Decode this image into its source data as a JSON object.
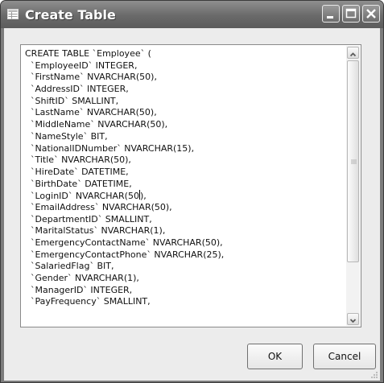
{
  "window": {
    "title": "Create Table"
  },
  "editor": {
    "lines": [
      "CREATE TABLE `Employee` (",
      "  `EmployeeID` INTEGER,",
      "  `FirstName` NVARCHAR(50),",
      "  `AddressID` INTEGER,",
      "  `ShiftID` SMALLINT,",
      "  `LastName` NVARCHAR(50),",
      "  `MiddleName` NVARCHAR(50),",
      "  `NameStyle` BIT,",
      "  `NationalIDNumber` NVARCHAR(15),",
      "  `Title` NVARCHAR(50),",
      "  `HireDate` DATETIME,",
      "  `BirthDate` DATETIME,",
      "  `LoginID` NVARCHAR(50),",
      "  `EmailAddress` NVARCHAR(50),",
      "  `DepartmentID` SMALLINT,",
      "  `MaritalStatus` NVARCHAR(1),",
      "  `EmergencyContactName` NVARCHAR(50),",
      "  `EmergencyContactPhone` NVARCHAR(25),",
      "  `SalariedFlag` BIT,",
      "  `Gender` NVARCHAR(1),",
      "  `ManagerID` INTEGER,",
      "  `PayFrequency` SMALLINT,"
    ]
  },
  "buttons": {
    "ok_label": "OK",
    "cancel_label": "Cancel"
  },
  "icons": {
    "app": "table-window-icon",
    "minimize": "minimize-icon",
    "maximize": "maximize-icon",
    "close": "close-icon",
    "scroll_up": "chevron-up-icon",
    "scroll_down": "chevron-down-icon"
  }
}
